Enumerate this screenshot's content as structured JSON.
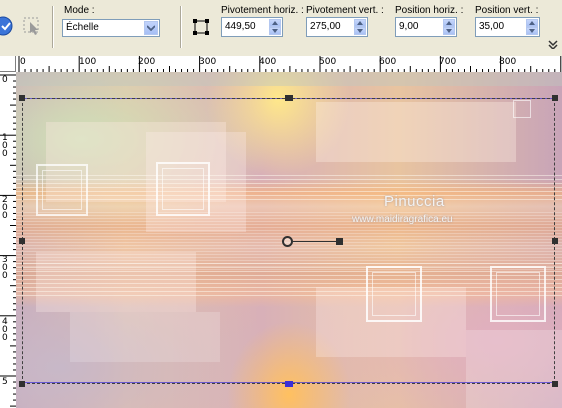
{
  "toolbar": {
    "mode": {
      "label": "Mode :",
      "value": "Échelle"
    },
    "pivot_h": {
      "label": "Pivotement horiz. :",
      "value": "449,50"
    },
    "pivot_v": {
      "label": "Pivotement vert. :",
      "value": "275,00"
    },
    "pos_h": {
      "label": "Position horiz. :",
      "value": "9,00"
    },
    "pos_v": {
      "label": "Position vert. :",
      "value": "35,00"
    }
  },
  "hruler": {
    "labels": [
      "0",
      "100",
      "200",
      "300",
      "400",
      "500",
      "600",
      "700",
      "800"
    ]
  },
  "vruler": {
    "labels": [
      "0",
      "1 0 0",
      "2 0 0",
      "3 0 0",
      "4 0 0",
      "5"
    ]
  },
  "watermark": {
    "line1": "Pinuccia",
    "line2": "www.maidiragrafica.eu"
  },
  "colors": {
    "selection_handle": "#303030",
    "guide_accent": "#3a2fd8"
  }
}
